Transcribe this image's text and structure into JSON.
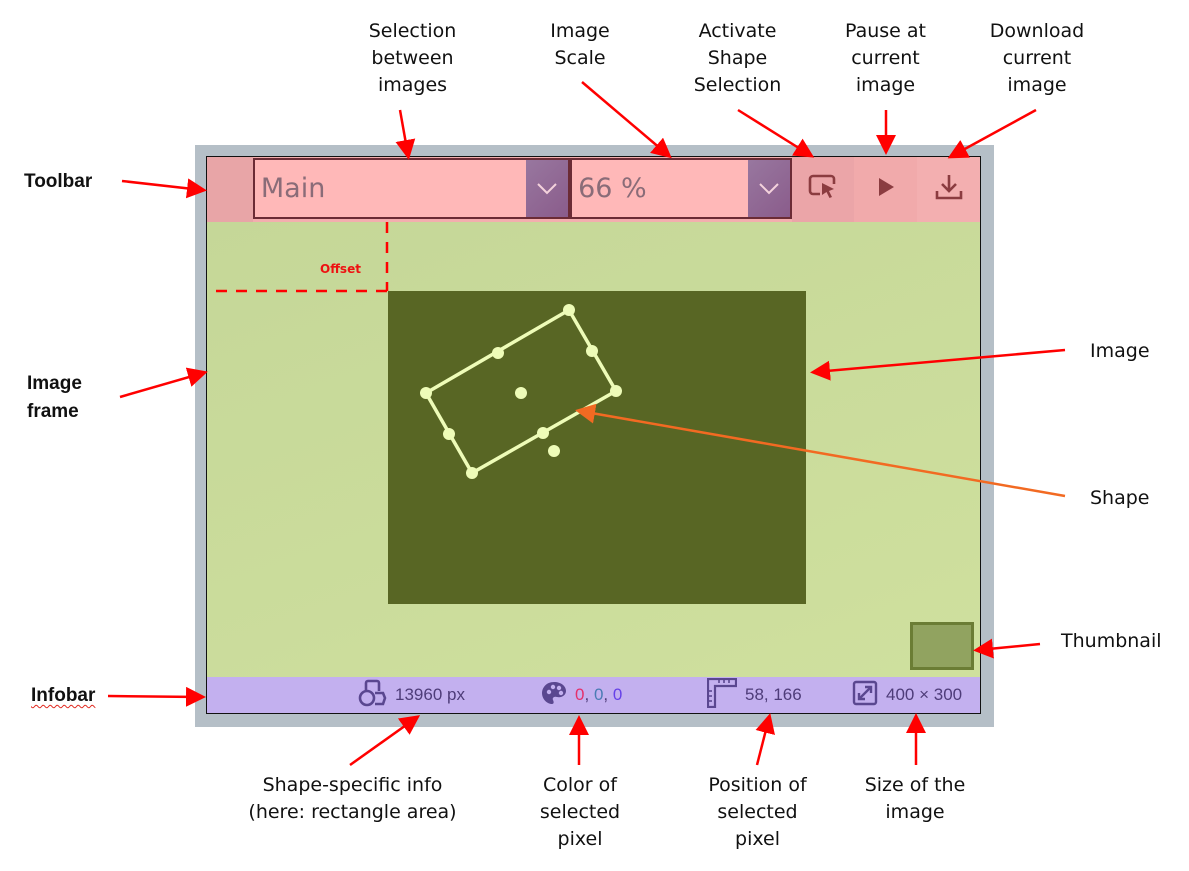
{
  "callouts": {
    "selection_between_images": "Selection between images",
    "image_scale": "Image Scale",
    "activate_shape_selection": "Activate Shape Selection",
    "pause_at_current_image": "Pause at current image",
    "download_current_image": "Download current image",
    "toolbar": "Toolbar",
    "image_frame": "Image frame",
    "infobar": "Infobar",
    "image": "Image",
    "shape": "Shape",
    "thumbnail": "Thumbnail",
    "offset": "Offset",
    "shape_info": "Shape-specific info (here: rectangle area)",
    "pixel_color": "Color of selected pixel",
    "pixel_position": "Position of selected pixel",
    "image_size": "Size of the image"
  },
  "toolbar": {
    "image_select": {
      "value": "Main",
      "icon": "chevron-down-icon"
    },
    "scale_select": {
      "value": "66 %",
      "icon": "chevron-down-icon"
    },
    "buttons": [
      {
        "label": "Activate Shape Selection",
        "icon": "shape-select-icon"
      },
      {
        "label": "Pause at current image",
        "icon": "play-icon"
      },
      {
        "label": "Download current image",
        "icon": "download-icon"
      }
    ]
  },
  "infobar": {
    "shape_area": {
      "icon": "shapes-icon",
      "value": "13960 px"
    },
    "pixel_color": {
      "icon": "palette-icon",
      "r": "0",
      "g": "0",
      "b": "0",
      "separator": ","
    },
    "pixel_position": {
      "icon": "ruler-icon",
      "value": "58, 166"
    },
    "image_size": {
      "icon": "resize-icon",
      "value": "400 × 300"
    }
  },
  "colors": {
    "toolbar": "#f3aeae",
    "dropdown_arrow": "#8f6a93",
    "image_frame_bg": "#c9da9c",
    "image": "#586624",
    "shape_stroke": "#eefcb8",
    "infobar": "#c3b0ef",
    "annotation_arrow": "#ff0000",
    "annotation_arrow_alt": "#f26a22"
  }
}
